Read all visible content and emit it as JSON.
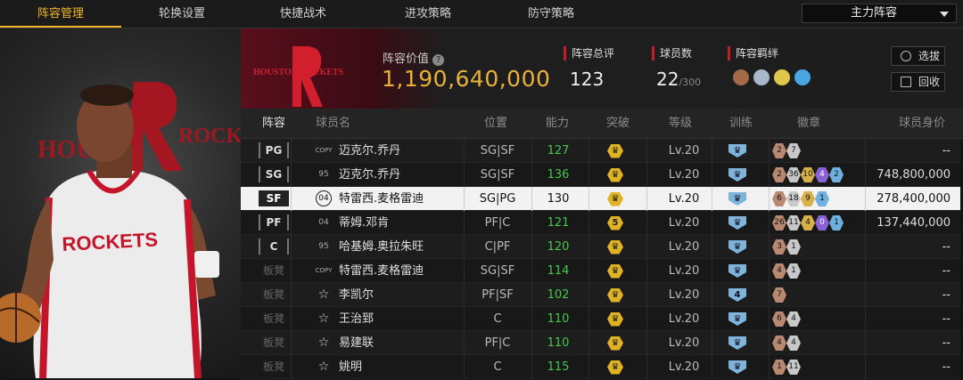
{
  "tabs": [
    {
      "label": "阵容管理",
      "active": true
    },
    {
      "label": "轮换设置",
      "active": false
    },
    {
      "label": "快捷战术",
      "active": false
    },
    {
      "label": "进攻策略",
      "active": false
    },
    {
      "label": "防守策略",
      "active": false
    }
  ],
  "lineup_select": {
    "value": "主力阵容"
  },
  "header": {
    "team_logo_text": "HOUSTON ROCKETS",
    "value_label": "阵容价值",
    "value": "1,190,640,000",
    "rating_label": "阵容总评",
    "rating": "123",
    "players_label": "球员数",
    "players": "22",
    "players_max": "/300",
    "bond_label": "阵容羁绊",
    "select_btn": "选拔",
    "recycle_btn": "回收"
  },
  "columns": [
    "阵容",
    "球员名",
    "位置",
    "能力",
    "突破",
    "等级",
    "训练",
    "徽章",
    "球员身价"
  ],
  "rows": [
    {
      "slot": "PG",
      "card": "COPY",
      "name": "迈克尔.乔丹",
      "pos": "SG|SF",
      "ability": "127",
      "breakthrough": "crown",
      "level": "Lv.20",
      "train": "crown",
      "badges": [
        {
          "v": "2",
          "c": "bronze"
        },
        {
          "v": "7",
          "c": "silver"
        }
      ],
      "value": "--"
    },
    {
      "slot": "SG",
      "card": "95",
      "name": "迈克尔.乔丹",
      "pos": "SG|SF",
      "ability": "136",
      "breakthrough": "crown",
      "level": "Lv.20",
      "train": "crown",
      "badges": [
        {
          "v": "2",
          "c": "bronze"
        },
        {
          "v": "36",
          "c": "silver"
        },
        {
          "v": "10",
          "c": "gold"
        },
        {
          "v": "4",
          "c": "purple"
        },
        {
          "v": "2",
          "c": "blue"
        }
      ],
      "value": "748,800,000"
    },
    {
      "slot": "SF",
      "card": "04",
      "name": "特雷西.麦格雷迪",
      "pos": "SG|PG",
      "ability": "130",
      "breakthrough": "crown",
      "level": "Lv.20",
      "train": "crown",
      "badges": [
        {
          "v": "6",
          "c": "bronze"
        },
        {
          "v": "18",
          "c": "silver"
        },
        {
          "v": "9",
          "c": "gold"
        },
        {
          "v": "1",
          "c": "blue"
        }
      ],
      "value": "278,400,000",
      "selected": true
    },
    {
      "slot": "PF",
      "card": "04",
      "name": "蒂姆.邓肯",
      "pos": "PF|C",
      "ability": "121",
      "breakthrough": "5",
      "level": "Lv.20",
      "train": "crown",
      "badges": [
        {
          "v": "26",
          "c": "bronze"
        },
        {
          "v": "11",
          "c": "silver"
        },
        {
          "v": "4",
          "c": "gold"
        },
        {
          "v": "0",
          "c": "purple"
        },
        {
          "v": "1",
          "c": "blue"
        }
      ],
      "value": "137,440,000"
    },
    {
      "slot": "C",
      "card": "95",
      "name": "哈基姆.奥拉朱旺",
      "pos": "C|PF",
      "ability": "120",
      "breakthrough": "crown",
      "level": "Lv.20",
      "train": "crown",
      "badges": [
        {
          "v": "3",
          "c": "bronze"
        },
        {
          "v": "1",
          "c": "silver"
        }
      ],
      "value": "--"
    },
    {
      "slot": "板凳",
      "card": "COPY",
      "name": "特雷西.麦格雷迪",
      "pos": "SG|SF",
      "ability": "114",
      "breakthrough": "crown",
      "level": "Lv.20",
      "train": "crown",
      "badges": [
        {
          "v": "4",
          "c": "bronze"
        },
        {
          "v": "1",
          "c": "silver"
        }
      ],
      "value": "--"
    },
    {
      "slot": "板凳",
      "card": "star",
      "name": "李凯尔",
      "pos": "PF|SF",
      "ability": "102",
      "breakthrough": "crown",
      "level": "Lv.20",
      "train": "4",
      "badges": [
        {
          "v": "7",
          "c": "bronze"
        }
      ],
      "value": "--"
    },
    {
      "slot": "板凳",
      "card": "star",
      "name": "王治郅",
      "pos": "C",
      "ability": "110",
      "breakthrough": "crown",
      "level": "Lv.20",
      "train": "crown",
      "badges": [
        {
          "v": "6",
          "c": "bronze"
        },
        {
          "v": "4",
          "c": "silver"
        }
      ],
      "value": "--"
    },
    {
      "slot": "板凳",
      "card": "star",
      "name": "易建联",
      "pos": "PF|C",
      "ability": "110",
      "breakthrough": "crown",
      "level": "Lv.20",
      "train": "crown",
      "badges": [
        {
          "v": "4",
          "c": "bronze"
        },
        {
          "v": "4",
          "c": "silver"
        }
      ],
      "value": "--"
    },
    {
      "slot": "板凳",
      "card": "star",
      "name": "姚明",
      "pos": "C",
      "ability": "115",
      "breakthrough": "crown",
      "level": "Lv.20",
      "train": "crown",
      "badges": [
        {
          "v": "1",
          "c": "bronze"
        },
        {
          "v": "11",
          "c": "silver"
        }
      ],
      "value": "--"
    }
  ],
  "player_art": {
    "jersey_text": "ROCKETS",
    "bg_text": "HOUSTON ROCKETS"
  }
}
